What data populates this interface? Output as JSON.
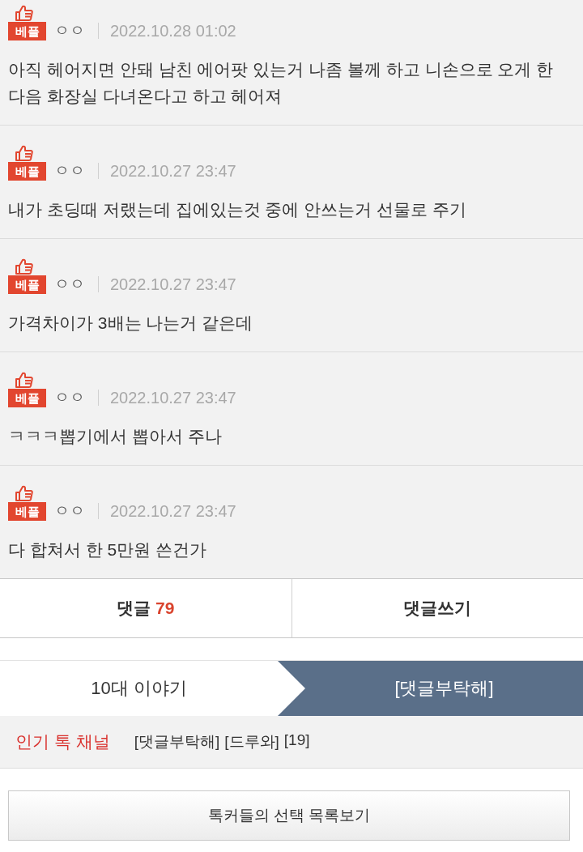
{
  "comments": [
    {
      "badge": "베플",
      "author": "ㅇㅇ",
      "date": "2022.10.28 01:02",
      "text": "아직 헤어지면 안돼 남친 에어팟 있는거 나좀 볼께 하고 니손으로 오게 한 다음 화장실 다녀온다고 하고 헤어져"
    },
    {
      "badge": "베플",
      "author": "ㅇㅇ",
      "date": "2022.10.27 23:47",
      "text": "내가 초딩때 저랬는데 집에있는것 중에 안쓰는거 선물로 주기"
    },
    {
      "badge": "베플",
      "author": "ㅇㅇ",
      "date": "2022.10.27 23:47",
      "text": "가격차이가 3배는 나는거 같은데"
    },
    {
      "badge": "베플",
      "author": "ㅇㅇ",
      "date": "2022.10.27 23:47",
      "text": "ㅋㅋㅋ뽑기에서 뽑아서 주나"
    },
    {
      "badge": "베플",
      "author": "ㅇㅇ",
      "date": "2022.10.27 23:47",
      "text": "다 합쳐서 한 5만원 쓴건가"
    }
  ],
  "comment_bar": {
    "comments_label": "댓글",
    "comments_count": "79",
    "write_label": "댓글쓰기"
  },
  "breadcrumb": [
    {
      "label": "10대 이야기",
      "selected": false
    },
    {
      "label": "[댓글부탁해]",
      "selected": true
    }
  ],
  "popular_channels": {
    "title": "인기 톡 채널",
    "links": [
      "[댓글부탁해]",
      "[드루와]",
      "[19]"
    ]
  },
  "list_button": {
    "label": "톡커들의 선택 목록보기"
  }
}
